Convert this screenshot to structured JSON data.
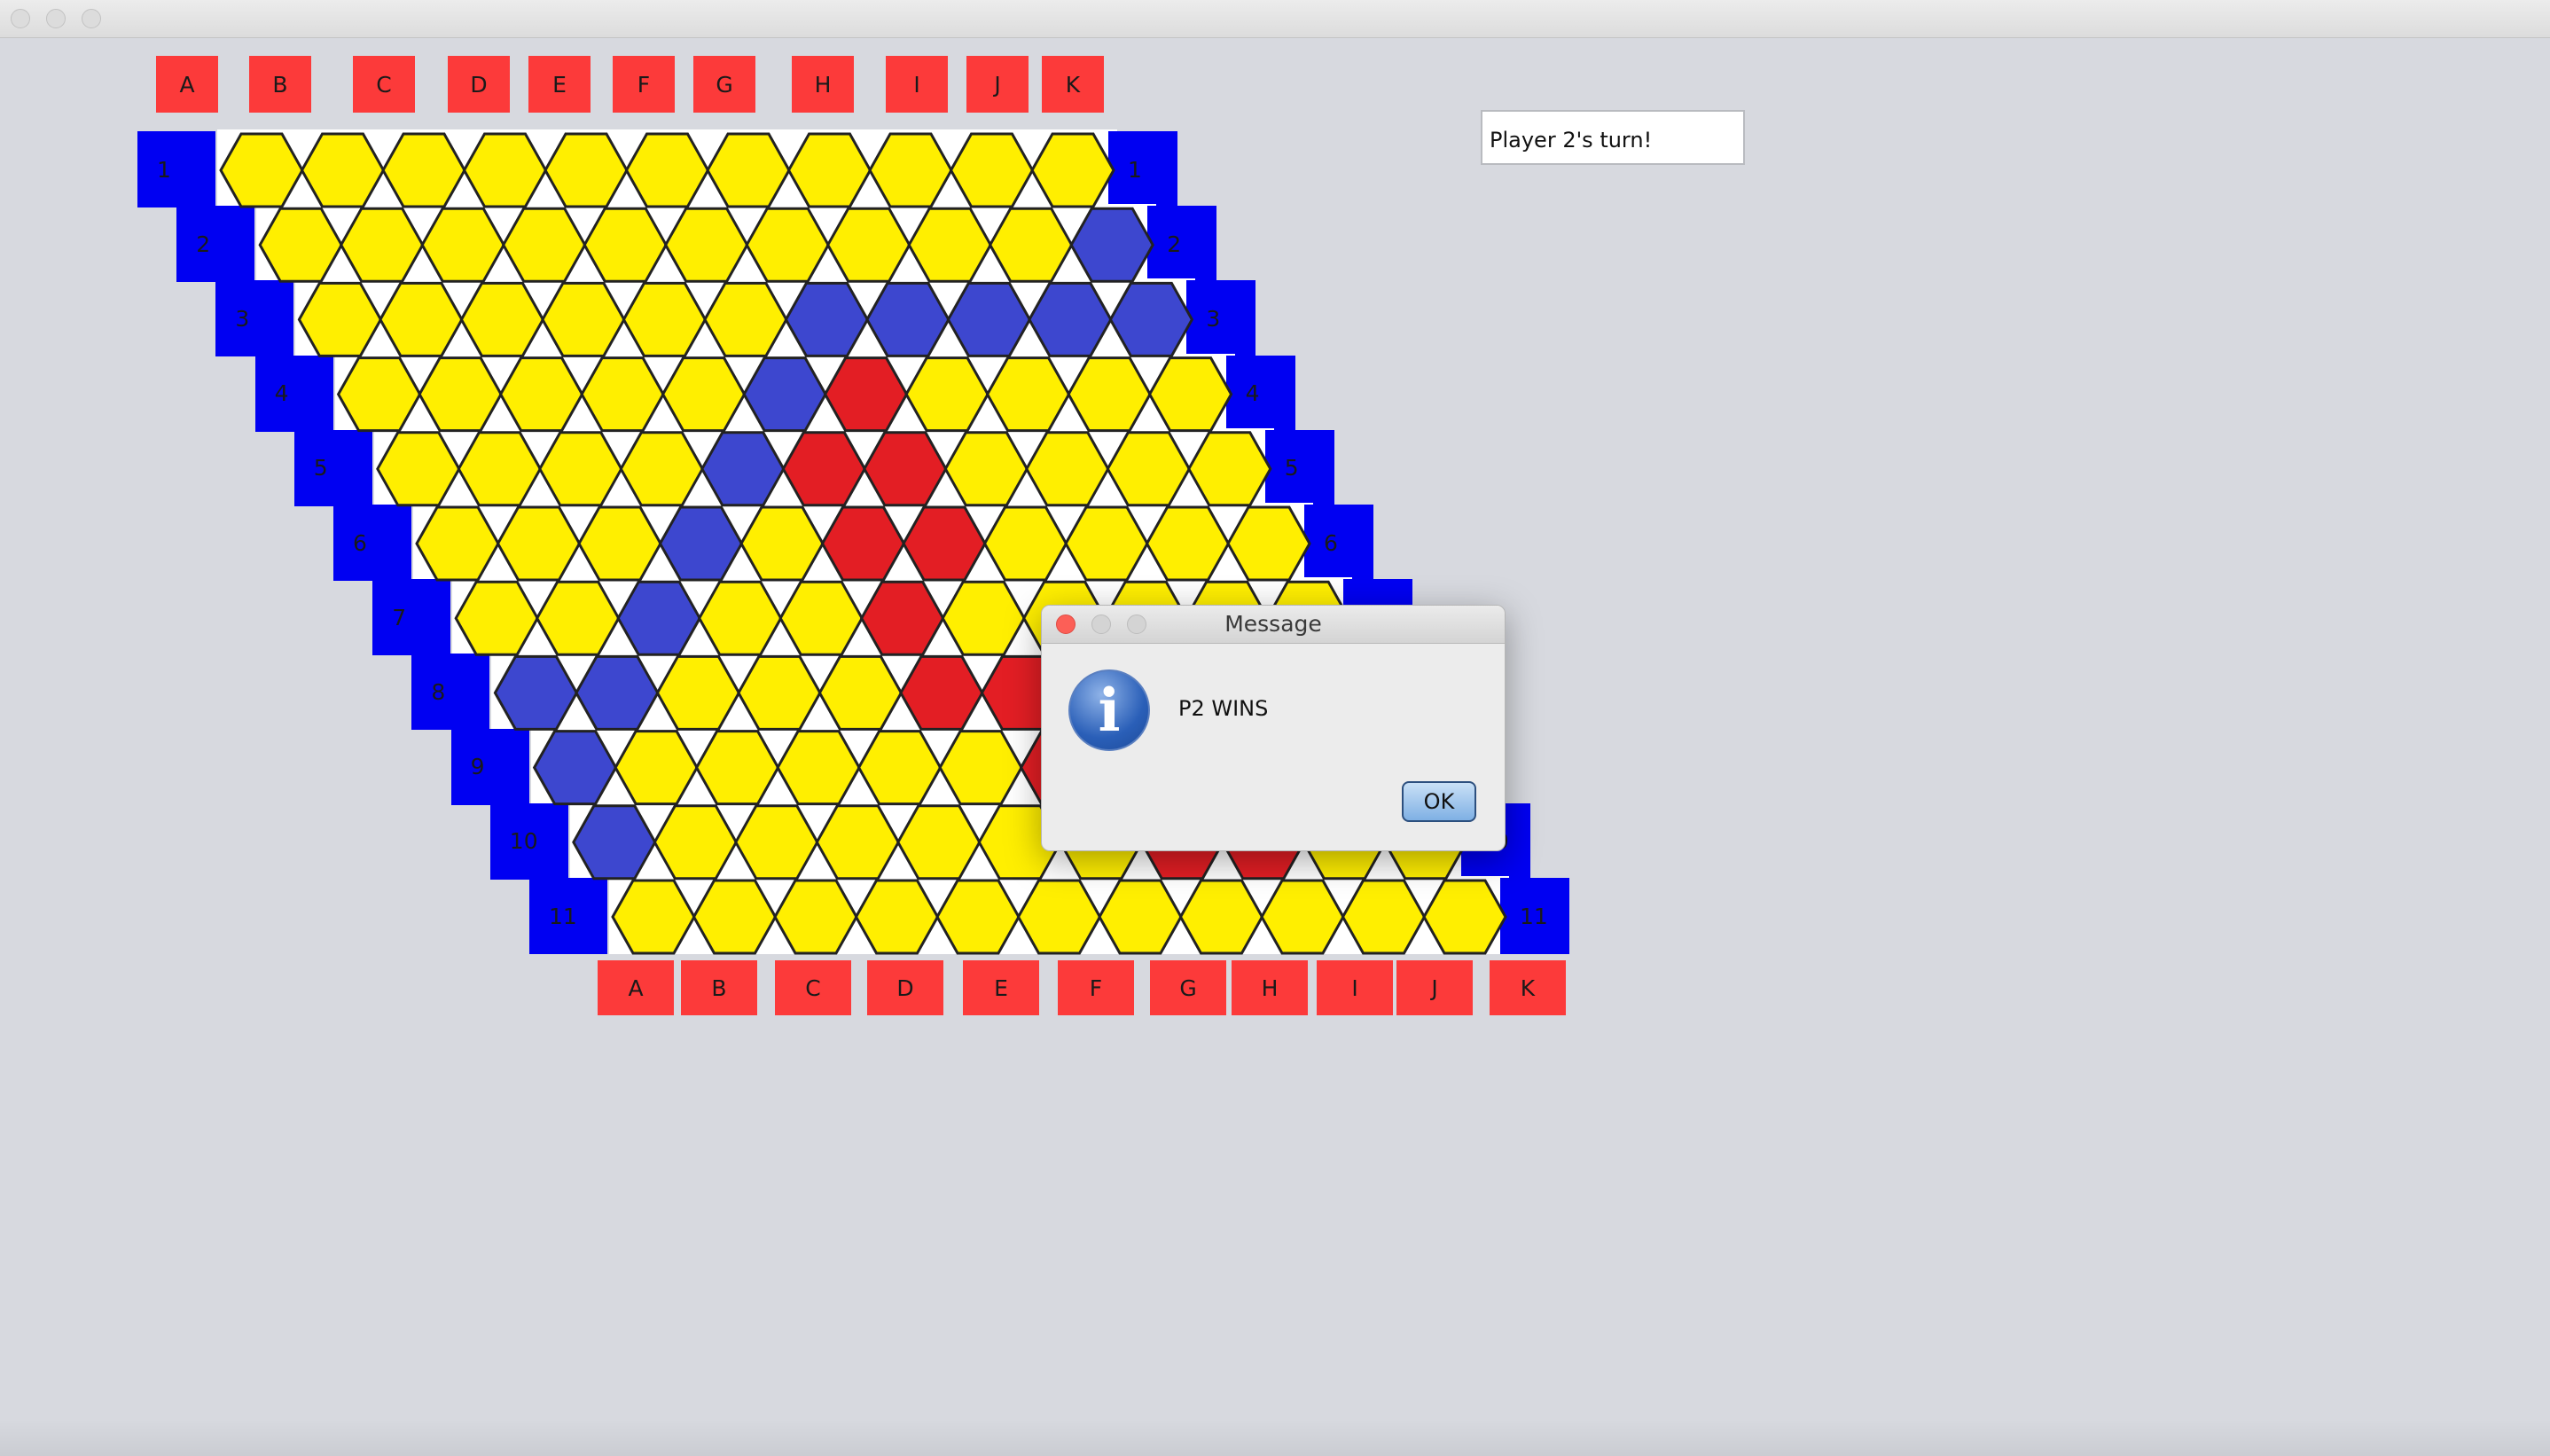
{
  "window": {
    "title": ""
  },
  "colors": {
    "background": "#d7d9df",
    "column_label_bg": "#fc3a3a",
    "row_label_bg": "#0000f2",
    "empty_cell": "#ffef00",
    "player1_cell": "#e31e24",
    "player2_cell": "#3d47cf",
    "cell_stroke": "#222222"
  },
  "top_labels": [
    "A",
    "B",
    "C",
    "D",
    "E",
    "F",
    "G",
    "H",
    "I",
    "J",
    "K"
  ],
  "bottom_labels": [
    "A",
    "B",
    "C",
    "D",
    "E",
    "F",
    "G",
    "H",
    "I",
    "J",
    "K"
  ],
  "row_labels": [
    "1",
    "2",
    "3",
    "4",
    "5",
    "6",
    "7",
    "8",
    "9",
    "10",
    "11"
  ],
  "board": {
    "legend": {
      "Y": "empty",
      "R": "red",
      "B": "blue"
    },
    "rows": [
      "YYYYYYYYYYY",
      "YYYYYYYYYYB",
      "YYYYYYBBBBB",
      "YYYYYBRYYYY",
      "YYYYBRRYYYY",
      "YYYBYRRYYYY",
      "YYBYYRYYYYY",
      "BBYYYRRYYYY",
      "BYYYYYRYYYY",
      "BYYYYYYRRYY",
      "YYYYYYYYYYY"
    ]
  },
  "status": {
    "text": "Player 2's turn!"
  },
  "dialog": {
    "title": "Message",
    "message": "P2 WINS",
    "ok_label": "OK",
    "icon": "info-icon"
  }
}
